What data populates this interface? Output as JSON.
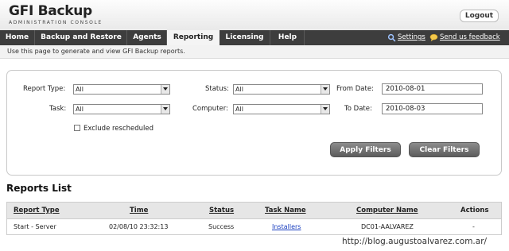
{
  "header": {
    "logo_main": "GFI Backup",
    "logo_sub": "ADMINISTRATION CONSOLE",
    "logout_label": "Logout"
  },
  "nav": {
    "tabs": [
      {
        "label": "Home"
      },
      {
        "label": "Backup and Restore"
      },
      {
        "label": "Agents"
      },
      {
        "label": "Reporting",
        "active": true
      },
      {
        "label": "Licensing"
      },
      {
        "label": "Help"
      }
    ],
    "settings_label": "Settings",
    "feedback_label": "Send us feedback",
    "settings_icon": "gear-icon",
    "feedback_icon": "speech-bubble-icon"
  },
  "info": {
    "text": "Use this page to generate and view GFI Backup reports."
  },
  "filters": {
    "report_type_label": "Report Type:",
    "report_type_value": "All",
    "task_label": "Task:",
    "task_value": "All",
    "status_label": "Status:",
    "status_value": "All",
    "computer_label": "Computer:",
    "computer_value": "All",
    "from_date_label": "From Date:",
    "from_date_value": "2010-08-01",
    "to_date_label": "To Date:",
    "to_date_value": "2010-08-03",
    "exclude_label": "Exclude rescheduled",
    "exclude_checked": false,
    "apply_label": "Apply Filters",
    "clear_label": "Clear Filters"
  },
  "reports": {
    "title": "Reports List",
    "columns": [
      "Report Type",
      "Time",
      "Status",
      "Task Name",
      "Computer Name",
      "Actions"
    ],
    "rows": [
      {
        "report_type": "Start - Server",
        "time": "02/08/10 23:32:13",
        "status": "Success",
        "task_name": "Installers",
        "computer_name": "DC01-AALVAREZ",
        "actions": "-"
      }
    ]
  },
  "watermark": "http://blog.augustoalvarez.com.ar/"
}
